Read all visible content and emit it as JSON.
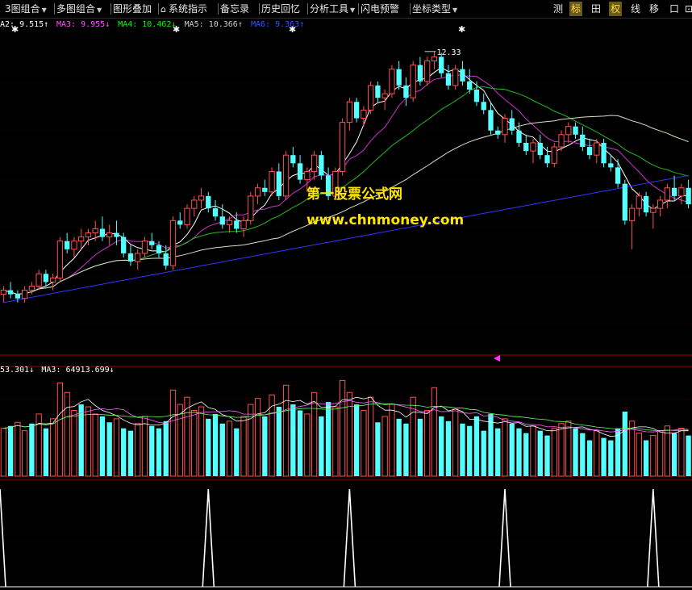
{
  "toolbar": {
    "left": [
      {
        "label": "3图组合",
        "dropdown": true
      },
      {
        "label": "多图组合",
        "dropdown": true
      },
      {
        "label": "图形叠加",
        "dropdown": false
      },
      {
        "label": "系统指示",
        "dropdown": false
      },
      {
        "label": "备忘录",
        "dropdown": false
      },
      {
        "label": "历史回忆",
        "dropdown": false
      },
      {
        "label": "分析工具",
        "dropdown": true
      },
      {
        "label": "闪电预警",
        "dropdown": false
      },
      {
        "label": "坐标类型",
        "dropdown": true
      }
    ],
    "right": [
      {
        "label": "测",
        "active": false
      },
      {
        "label": "标",
        "active": true
      },
      {
        "label": "田",
        "active": false
      },
      {
        "label": "权",
        "active": true
      },
      {
        "label": "线",
        "active": false
      },
      {
        "label": "移",
        "active": false
      },
      {
        "label": "口",
        "active": false
      },
      {
        "label": "⊡",
        "active": false
      }
    ]
  },
  "price_panel": {
    "legend": [
      {
        "text": "A2: 9.515↑",
        "color": "#ffffff"
      },
      {
        "text": "MA3: 9.955↓",
        "color": "#ff55ff"
      },
      {
        "text": "MA4: 10.462↓",
        "color": "#00ff00"
      },
      {
        "text": "MA5: 10.366↑",
        "color": "#d0d0d0"
      },
      {
        "text": "MA6: 9.363↑",
        "color": "#3355ff"
      }
    ],
    "high_label": "12.33",
    "watermark_cn": "第一股票公式网",
    "watermark_url": "www.chnmoney.com"
  },
  "volume_panel": {
    "legend": [
      {
        "text": "53.301↓",
        "color": "#ffffff"
      },
      {
        "text": "MA3: 64913.699↓",
        "color": "#ffffff"
      }
    ]
  },
  "colors": {
    "up": "#ff5050",
    "down": "#54ffff",
    "grid": "#7a0000",
    "ma_white": "#ffffff",
    "ma_magenta": "#cc33cc",
    "ma_green": "#22bb22",
    "ma_beige": "#e0dcc0",
    "ma_blue": "#3333ff"
  },
  "chart_data": {
    "type": "candlestick",
    "candles": [
      [
        6.4,
        6.6,
        6.2,
        6.5
      ],
      [
        6.5,
        6.7,
        6.3,
        6.4
      ],
      [
        6.4,
        6.5,
        6.2,
        6.3
      ],
      [
        6.3,
        6.6,
        6.2,
        6.5
      ],
      [
        6.5,
        6.7,
        6.4,
        6.6
      ],
      [
        6.6,
        7.0,
        6.5,
        6.9
      ],
      [
        6.9,
        7.0,
        6.6,
        6.7
      ],
      [
        6.7,
        6.9,
        6.5,
        6.8
      ],
      [
        6.8,
        7.8,
        6.7,
        7.7
      ],
      [
        7.7,
        7.9,
        7.4,
        7.5
      ],
      [
        7.5,
        7.8,
        7.3,
        7.7
      ],
      [
        7.7,
        8.0,
        7.5,
        7.8
      ],
      [
        7.8,
        8.0,
        7.6,
        7.9
      ],
      [
        7.9,
        8.2,
        7.7,
        8.0
      ],
      [
        8.0,
        8.3,
        7.7,
        7.8
      ],
      [
        7.8,
        8.1,
        7.6,
        7.9
      ],
      [
        7.9,
        8.2,
        7.6,
        7.8
      ],
      [
        7.8,
        7.9,
        7.3,
        7.4
      ],
      [
        7.4,
        7.6,
        7.1,
        7.2
      ],
      [
        7.2,
        7.5,
        7.0,
        7.4
      ],
      [
        7.4,
        7.8,
        7.3,
        7.7
      ],
      [
        7.7,
        7.9,
        7.5,
        7.6
      ],
      [
        7.6,
        7.7,
        7.3,
        7.4
      ],
      [
        7.4,
        7.6,
        7.0,
        7.1
      ],
      [
        7.1,
        8.3,
        7.0,
        8.2
      ],
      [
        8.2,
        8.4,
        8.0,
        8.1
      ],
      [
        8.1,
        8.6,
        8.0,
        8.5
      ],
      [
        8.5,
        8.8,
        8.3,
        8.7
      ],
      [
        8.7,
        9.0,
        8.5,
        8.8
      ],
      [
        8.8,
        8.9,
        8.4,
        8.5
      ],
      [
        8.5,
        8.7,
        8.2,
        8.3
      ],
      [
        8.3,
        8.6,
        8.0,
        8.1
      ],
      [
        8.1,
        8.3,
        7.9,
        8.2
      ],
      [
        8.2,
        8.4,
        7.9,
        8.0
      ],
      [
        8.0,
        8.3,
        7.8,
        8.2
      ],
      [
        8.2,
        8.9,
        8.1,
        8.8
      ],
      [
        8.8,
        9.1,
        8.6,
        9.0
      ],
      [
        9.0,
        9.2,
        8.8,
        8.9
      ],
      [
        8.9,
        9.5,
        8.8,
        9.4
      ],
      [
        9.4,
        9.6,
        8.7,
        8.8
      ],
      [
        8.8,
        9.9,
        8.7,
        9.8
      ],
      [
        9.8,
        10.0,
        9.5,
        9.6
      ],
      [
        9.6,
        9.8,
        9.1,
        9.2
      ],
      [
        9.2,
        9.5,
        8.9,
        9.4
      ],
      [
        9.4,
        9.9,
        9.2,
        9.8
      ],
      [
        9.8,
        9.9,
        9.2,
        9.3
      ],
      [
        9.3,
        9.5,
        8.7,
        8.8
      ],
      [
        8.8,
        9.5,
        8.7,
        9.4
      ],
      [
        9.4,
        10.7,
        9.3,
        10.6
      ],
      [
        10.6,
        11.2,
        10.4,
        11.1
      ],
      [
        11.1,
        11.2,
        10.6,
        10.7
      ],
      [
        10.7,
        11.0,
        10.5,
        10.9
      ],
      [
        10.9,
        11.6,
        10.8,
        11.5
      ],
      [
        11.5,
        11.6,
        11.1,
        11.2
      ],
      [
        11.2,
        11.4,
        10.9,
        11.3
      ],
      [
        11.3,
        12.0,
        11.2,
        11.9
      ],
      [
        11.9,
        12.1,
        11.4,
        11.5
      ],
      [
        11.5,
        11.7,
        11.0,
        11.2
      ],
      [
        11.2,
        12.1,
        11.1,
        12.0
      ],
      [
        12.0,
        12.2,
        11.5,
        11.6
      ],
      [
        11.6,
        12.2,
        11.5,
        12.1
      ],
      [
        12.1,
        12.33,
        11.9,
        12.2
      ],
      [
        12.2,
        12.3,
        11.7,
        11.8
      ],
      [
        11.8,
        12.0,
        11.4,
        11.5
      ],
      [
        11.5,
        12.0,
        11.4,
        11.9
      ],
      [
        11.9,
        12.1,
        11.5,
        11.6
      ],
      [
        11.6,
        11.9,
        11.3,
        11.4
      ],
      [
        11.4,
        11.6,
        11.0,
        11.1
      ],
      [
        11.1,
        11.3,
        10.8,
        10.9
      ],
      [
        10.9,
        11.1,
        10.3,
        10.4
      ],
      [
        10.4,
        10.5,
        10.2,
        10.3
      ],
      [
        10.3,
        10.8,
        10.1,
        10.7
      ],
      [
        10.7,
        10.9,
        10.3,
        10.4
      ],
      [
        10.4,
        10.6,
        10.0,
        10.1
      ],
      [
        10.1,
        10.3,
        9.8,
        9.9
      ],
      [
        9.9,
        10.2,
        9.6,
        10.1
      ],
      [
        10.1,
        10.3,
        9.7,
        9.8
      ],
      [
        9.8,
        10.0,
        9.5,
        9.6
      ],
      [
        9.6,
        10.1,
        9.5,
        10.0
      ],
      [
        10.0,
        10.4,
        9.9,
        10.3
      ],
      [
        10.3,
        10.6,
        10.1,
        10.5
      ],
      [
        10.5,
        10.6,
        10.2,
        10.3
      ],
      [
        10.3,
        10.5,
        9.9,
        10.0
      ],
      [
        10.0,
        10.2,
        9.7,
        9.8
      ],
      [
        9.8,
        10.2,
        9.6,
        10.1
      ],
      [
        10.1,
        10.2,
        9.5,
        9.6
      ],
      [
        9.6,
        9.8,
        9.4,
        9.5
      ],
      [
        9.5,
        9.7,
        9.0,
        9.1
      ],
      [
        9.1,
        9.2,
        8.1,
        8.2
      ],
      [
        8.2,
        8.6,
        7.5,
        8.5
      ],
      [
        8.5,
        8.9,
        8.3,
        8.8
      ],
      [
        8.8,
        8.9,
        8.3,
        8.4
      ],
      [
        8.4,
        8.6,
        8.0,
        8.5
      ],
      [
        8.5,
        8.8,
        8.3,
        8.7
      ],
      [
        8.7,
        9.1,
        8.5,
        9.0
      ],
      [
        9.0,
        9.3,
        8.7,
        8.8
      ],
      [
        8.8,
        9.1,
        8.6,
        9.0
      ],
      [
        9.0,
        9.2,
        8.5,
        8.6
      ]
    ],
    "volume": [
      [
        40,
        1
      ],
      [
        42,
        0
      ],
      [
        45,
        1
      ],
      [
        38,
        1
      ],
      [
        44,
        0
      ],
      [
        52,
        1
      ],
      [
        40,
        0
      ],
      [
        48,
        1
      ],
      [
        78,
        1
      ],
      [
        70,
        1
      ],
      [
        55,
        1
      ],
      [
        60,
        0
      ],
      [
        58,
        1
      ],
      [
        52,
        1
      ],
      [
        50,
        0
      ],
      [
        45,
        0
      ],
      [
        48,
        1
      ],
      [
        40,
        0
      ],
      [
        38,
        0
      ],
      [
        44,
        1
      ],
      [
        50,
        1
      ],
      [
        42,
        0
      ],
      [
        40,
        0
      ],
      [
        46,
        0
      ],
      [
        72,
        1
      ],
      [
        60,
        1
      ],
      [
        66,
        1
      ],
      [
        55,
        1
      ],
      [
        58,
        1
      ],
      [
        48,
        0
      ],
      [
        52,
        0
      ],
      [
        44,
        0
      ],
      [
        46,
        1
      ],
      [
        40,
        0
      ],
      [
        50,
        1
      ],
      [
        60,
        1
      ],
      [
        65,
        1
      ],
      [
        50,
        0
      ],
      [
        68,
        1
      ],
      [
        58,
        0
      ],
      [
        76,
        1
      ],
      [
        60,
        0
      ],
      [
        55,
        0
      ],
      [
        52,
        1
      ],
      [
        70,
        1
      ],
      [
        50,
        0
      ],
      [
        62,
        0
      ],
      [
        58,
        1
      ],
      [
        80,
        1
      ],
      [
        70,
        1
      ],
      [
        60,
        0
      ],
      [
        55,
        1
      ],
      [
        66,
        1
      ],
      [
        45,
        0
      ],
      [
        50,
        1
      ],
      [
        60,
        1
      ],
      [
        48,
        0
      ],
      [
        44,
        0
      ],
      [
        66,
        1
      ],
      [
        48,
        0
      ],
      [
        55,
        1
      ],
      [
        74,
        1
      ],
      [
        50,
        0
      ],
      [
        46,
        0
      ],
      [
        56,
        1
      ],
      [
        44,
        0
      ],
      [
        42,
        0
      ],
      [
        50,
        0
      ],
      [
        38,
        0
      ],
      [
        52,
        0
      ],
      [
        40,
        0
      ],
      [
        48,
        1
      ],
      [
        44,
        0
      ],
      [
        40,
        0
      ],
      [
        36,
        0
      ],
      [
        42,
        1
      ],
      [
        38,
        0
      ],
      [
        34,
        0
      ],
      [
        40,
        1
      ],
      [
        44,
        1
      ],
      [
        46,
        1
      ],
      [
        40,
        0
      ],
      [
        36,
        0
      ],
      [
        30,
        0
      ],
      [
        38,
        1
      ],
      [
        32,
        0
      ],
      [
        30,
        0
      ],
      [
        40,
        0
      ],
      [
        54,
        0
      ],
      [
        46,
        1
      ],
      [
        36,
        1
      ],
      [
        30,
        0
      ],
      [
        34,
        1
      ],
      [
        38,
        1
      ],
      [
        42,
        1
      ],
      [
        36,
        0
      ],
      [
        40,
        1
      ],
      [
        34,
        0
      ]
    ],
    "signal_spikes": [
      0,
      29,
      49,
      71,
      92,
      109,
      126
    ],
    "visible_price_range": [
      5.9,
      12.8
    ]
  }
}
